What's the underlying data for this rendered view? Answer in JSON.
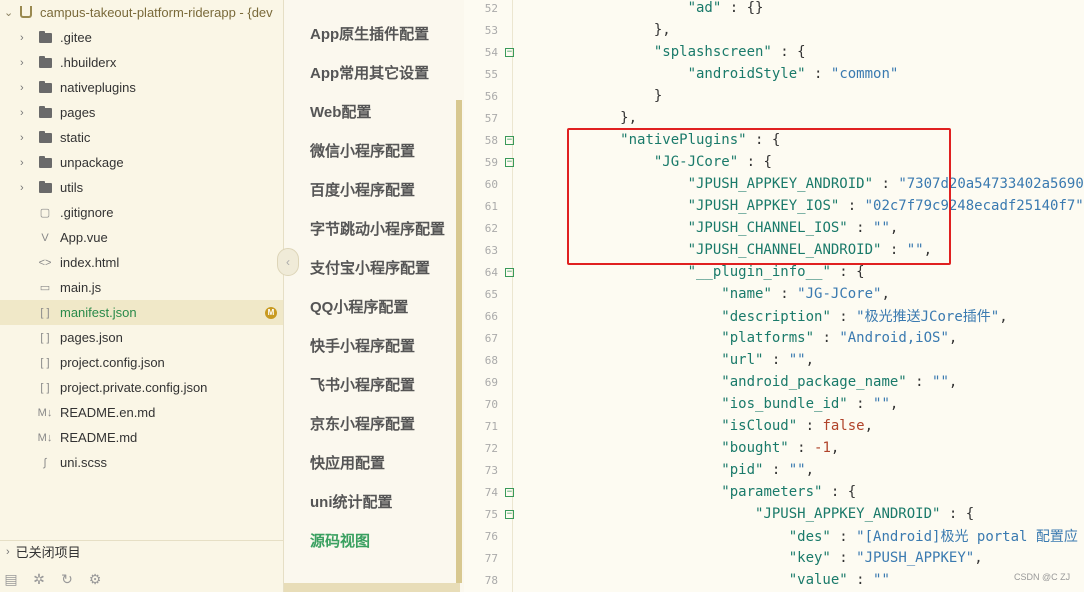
{
  "file_tree": {
    "root_label": "campus-takeout-platform-riderapp - {dev",
    "items": [
      {
        "name": ".gitee",
        "type": "folder",
        "expandable": true
      },
      {
        "name": ".hbuilderx",
        "type": "folder",
        "expandable": true
      },
      {
        "name": "nativeplugins",
        "type": "folder",
        "expandable": true
      },
      {
        "name": "pages",
        "type": "folder",
        "expandable": true
      },
      {
        "name": "static",
        "type": "folder",
        "expandable": true
      },
      {
        "name": "unpackage",
        "type": "folder",
        "expandable": true
      },
      {
        "name": "utils",
        "type": "folder",
        "expandable": true
      },
      {
        "name": ".gitignore",
        "type": "file",
        "icon": "file-icon"
      },
      {
        "name": "App.vue",
        "type": "file",
        "icon": "vue-file-icon"
      },
      {
        "name": "index.html",
        "type": "file",
        "icon": "html-file-icon"
      },
      {
        "name": "main.js",
        "type": "file",
        "icon": "js-file-icon"
      },
      {
        "name": "manifest.json",
        "type": "file",
        "icon": "json-file-icon",
        "selected": true,
        "badge": "M"
      },
      {
        "name": "pages.json",
        "type": "file",
        "icon": "json-file-icon"
      },
      {
        "name": "project.config.json",
        "type": "file",
        "icon": "json-file-icon"
      },
      {
        "name": "project.private.config.json",
        "type": "file",
        "icon": "json-file-icon"
      },
      {
        "name": "README.en.md",
        "type": "file",
        "icon": "markdown-file-icon"
      },
      {
        "name": "README.md",
        "type": "file",
        "icon": "markdown-file-icon"
      },
      {
        "name": "uni.scss",
        "type": "file",
        "icon": "scss-file-icon"
      }
    ],
    "closed_projects_label": "已关闭项目"
  },
  "settings_nav": {
    "items": [
      {
        "label": "App原生插件配置",
        "active": false
      },
      {
        "label": "App常用其它设置",
        "active": false
      },
      {
        "label": "Web配置",
        "active": false
      },
      {
        "label": "微信小程序配置",
        "active": false
      },
      {
        "label": "百度小程序配置",
        "active": false
      },
      {
        "label": "字节跳动小程序配置",
        "active": false
      },
      {
        "label": "支付宝小程序配置",
        "active": false
      },
      {
        "label": "QQ小程序配置",
        "active": false
      },
      {
        "label": "快手小程序配置",
        "active": false
      },
      {
        "label": "飞书小程序配置",
        "active": false
      },
      {
        "label": "京东小程序配置",
        "active": false
      },
      {
        "label": "快应用配置",
        "active": false
      },
      {
        "label": "uni统计配置",
        "active": false
      },
      {
        "label": "源码视图",
        "active": true
      }
    ]
  },
  "editor": {
    "lines": [
      {
        "num": "52",
        "fold": false,
        "indent": 5,
        "tokens": [
          [
            "k",
            "\"ad\""
          ],
          [
            "p",
            " : {}"
          ]
        ]
      },
      {
        "num": "53",
        "fold": false,
        "indent": 4,
        "tokens": [
          [
            "p",
            "},"
          ]
        ]
      },
      {
        "num": "54",
        "fold": true,
        "indent": 4,
        "tokens": [
          [
            "k",
            "\"splashscreen\""
          ],
          [
            "p",
            " : {"
          ]
        ]
      },
      {
        "num": "55",
        "fold": false,
        "indent": 5,
        "tokens": [
          [
            "k",
            "\"androidStyle\""
          ],
          [
            "p",
            " : "
          ],
          [
            "s",
            "\"common\""
          ]
        ]
      },
      {
        "num": "56",
        "fold": false,
        "indent": 4,
        "tokens": [
          [
            "p",
            "}"
          ]
        ]
      },
      {
        "num": "57",
        "fold": false,
        "indent": 3,
        "tokens": [
          [
            "p",
            "},"
          ]
        ]
      },
      {
        "num": "58",
        "fold": true,
        "indent": 3,
        "tokens": [
          [
            "k",
            "\"nativePlugins\""
          ],
          [
            "p",
            " : {"
          ]
        ]
      },
      {
        "num": "59",
        "fold": true,
        "indent": 4,
        "tokens": [
          [
            "k",
            "\"JG-JCore\""
          ],
          [
            "p",
            " : {"
          ]
        ]
      },
      {
        "num": "60",
        "fold": false,
        "indent": 5,
        "tokens": [
          [
            "k",
            "\"JPUSH_APPKEY_ANDROID\""
          ],
          [
            "p",
            " : "
          ],
          [
            "s",
            "\"7307d20a54733402a5690"
          ]
        ]
      },
      {
        "num": "61",
        "fold": false,
        "indent": 5,
        "tokens": [
          [
            "k",
            "\"JPUSH_APPKEY_IOS\""
          ],
          [
            "p",
            " : "
          ],
          [
            "s",
            "\"02c7f79c9248ecadf25140f7\""
          ]
        ]
      },
      {
        "num": "62",
        "fold": false,
        "indent": 5,
        "tokens": [
          [
            "k",
            "\"JPUSH_CHANNEL_IOS\""
          ],
          [
            "p",
            " : "
          ],
          [
            "s",
            "\"\""
          ],
          [
            "p",
            ","
          ]
        ]
      },
      {
        "num": "63",
        "fold": false,
        "indent": 5,
        "tokens": [
          [
            "k",
            "\"JPUSH_CHANNEL_ANDROID\""
          ],
          [
            "p",
            " : "
          ],
          [
            "s",
            "\"\""
          ],
          [
            "p",
            ","
          ]
        ]
      },
      {
        "num": "64",
        "fold": true,
        "indent": 5,
        "tokens": [
          [
            "k",
            "\"__plugin_info__\""
          ],
          [
            "p",
            " : {"
          ]
        ]
      },
      {
        "num": "65",
        "fold": false,
        "indent": 6,
        "tokens": [
          [
            "k",
            "\"name\""
          ],
          [
            "p",
            " : "
          ],
          [
            "s",
            "\"JG-JCore\""
          ],
          [
            "p",
            ","
          ]
        ]
      },
      {
        "num": "66",
        "fold": false,
        "indent": 6,
        "tokens": [
          [
            "k",
            "\"description\""
          ],
          [
            "p",
            " : "
          ],
          [
            "s",
            "\"极光推送JCore插件\""
          ],
          [
            "p",
            ","
          ]
        ]
      },
      {
        "num": "67",
        "fold": false,
        "indent": 6,
        "tokens": [
          [
            "k",
            "\"platforms\""
          ],
          [
            "p",
            " : "
          ],
          [
            "s",
            "\"Android,iOS\""
          ],
          [
            "p",
            ","
          ]
        ]
      },
      {
        "num": "68",
        "fold": false,
        "indent": 6,
        "tokens": [
          [
            "k",
            "\"url\""
          ],
          [
            "p",
            " : "
          ],
          [
            "s",
            "\"\""
          ],
          [
            "p",
            ","
          ]
        ]
      },
      {
        "num": "69",
        "fold": false,
        "indent": 6,
        "tokens": [
          [
            "k",
            "\"android_package_name\""
          ],
          [
            "p",
            " : "
          ],
          [
            "s",
            "\"\""
          ],
          [
            "p",
            ","
          ]
        ]
      },
      {
        "num": "70",
        "fold": false,
        "indent": 6,
        "tokens": [
          [
            "k",
            "\"ios_bundle_id\""
          ],
          [
            "p",
            " : "
          ],
          [
            "s",
            "\"\""
          ],
          [
            "p",
            ","
          ]
        ]
      },
      {
        "num": "71",
        "fold": false,
        "indent": 6,
        "tokens": [
          [
            "k",
            "\"isCloud\""
          ],
          [
            "p",
            " : "
          ],
          [
            "n",
            "false"
          ],
          [
            "p",
            ","
          ]
        ]
      },
      {
        "num": "72",
        "fold": false,
        "indent": 6,
        "tokens": [
          [
            "k",
            "\"bought\""
          ],
          [
            "p",
            " : "
          ],
          [
            "n",
            "-1"
          ],
          [
            "p",
            ","
          ]
        ]
      },
      {
        "num": "73",
        "fold": false,
        "indent": 6,
        "tokens": [
          [
            "k",
            "\"pid\""
          ],
          [
            "p",
            " : "
          ],
          [
            "s",
            "\"\""
          ],
          [
            "p",
            ","
          ]
        ]
      },
      {
        "num": "74",
        "fold": true,
        "indent": 6,
        "tokens": [
          [
            "k",
            "\"parameters\""
          ],
          [
            "p",
            " : {"
          ]
        ]
      },
      {
        "num": "75",
        "fold": true,
        "indent": 7,
        "tokens": [
          [
            "k",
            "\"JPUSH_APPKEY_ANDROID\""
          ],
          [
            "p",
            " : {"
          ]
        ]
      },
      {
        "num": "76",
        "fold": false,
        "indent": 8,
        "tokens": [
          [
            "k",
            "\"des\""
          ],
          [
            "p",
            " : "
          ],
          [
            "s",
            "\"[Android]极光 portal 配置应"
          ]
        ]
      },
      {
        "num": "77",
        "fold": false,
        "indent": 8,
        "tokens": [
          [
            "k",
            "\"key\""
          ],
          [
            "p",
            " : "
          ],
          [
            "s",
            "\"JPUSH_APPKEY\""
          ],
          [
            "p",
            ","
          ]
        ]
      },
      {
        "num": "78",
        "fold": false,
        "indent": 8,
        "tokens": [
          [
            "k",
            "\"value\""
          ],
          [
            "p",
            " : "
          ],
          [
            "s",
            "\"\""
          ]
        ]
      }
    ]
  },
  "watermark": "CSDN @C ZJ"
}
